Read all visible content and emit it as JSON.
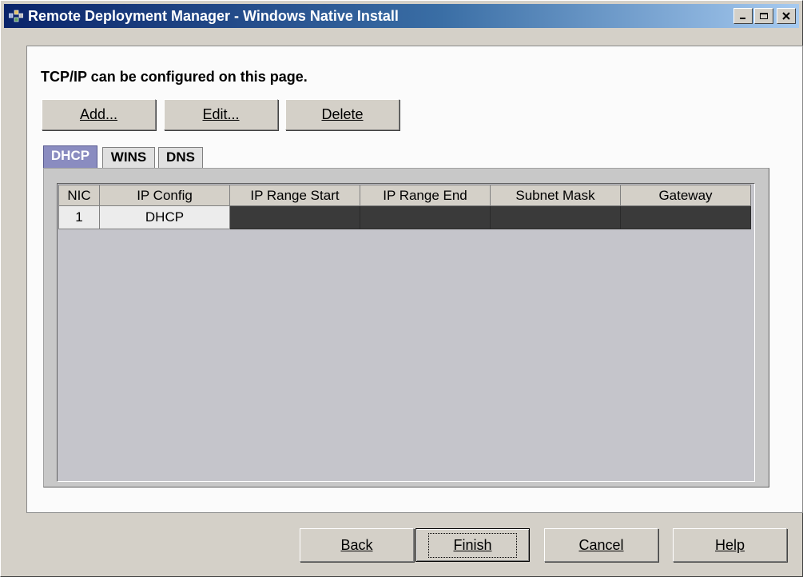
{
  "window": {
    "title": "Remote Deployment Manager - Windows Native Install",
    "minimize_icon": "minimize-icon",
    "maximize_icon": "maximize-icon",
    "close_icon": "close-icon"
  },
  "page": {
    "heading": "TCP/IP can be configured on this page."
  },
  "toolbar": {
    "add_label": "Add...",
    "edit_label": "Edit...",
    "delete_label": "Delete"
  },
  "tabs": [
    {
      "label": "DHCP",
      "active": true
    },
    {
      "label": "WINS",
      "active": false
    },
    {
      "label": "DNS",
      "active": false
    }
  ],
  "table": {
    "columns": [
      "NIC",
      "IP Config",
      "IP Range Start",
      "IP Range End",
      "Subnet Mask",
      "Gateway"
    ],
    "rows": [
      [
        "1",
        "DHCP",
        "",
        "",
        "",
        ""
      ]
    ]
  },
  "footer": {
    "back_label": "Back",
    "finish_label": "Finish",
    "cancel_label": "Cancel",
    "help_label": "Help"
  },
  "colors": {
    "titlebar_start": "#0a246a",
    "titlebar_end": "#a6caf0",
    "active_tab": "#8a8cc0",
    "disabled_cell": "#3a3a3a"
  }
}
